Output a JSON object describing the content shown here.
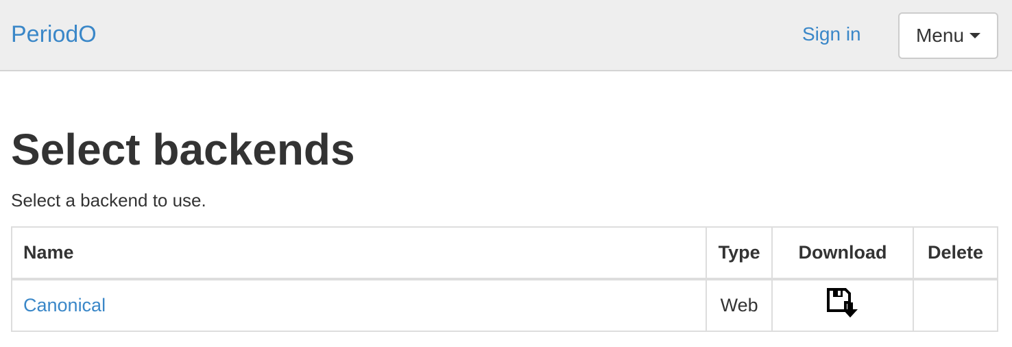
{
  "navbar": {
    "brand": "PeriodO",
    "signin_label": "Sign in",
    "menu_label": "Menu"
  },
  "page": {
    "title": "Select backends",
    "subtitle": "Select a backend to use."
  },
  "table": {
    "headers": {
      "name": "Name",
      "type": "Type",
      "download": "Download",
      "delete": "Delete"
    },
    "rows": [
      {
        "name": "Canonical",
        "type": "Web",
        "download_icon": "floppy-disk-download-icon"
      }
    ]
  },
  "colors": {
    "accent": "#3a87c8",
    "navbar_bg": "#eeeeee",
    "text": "#333333"
  }
}
